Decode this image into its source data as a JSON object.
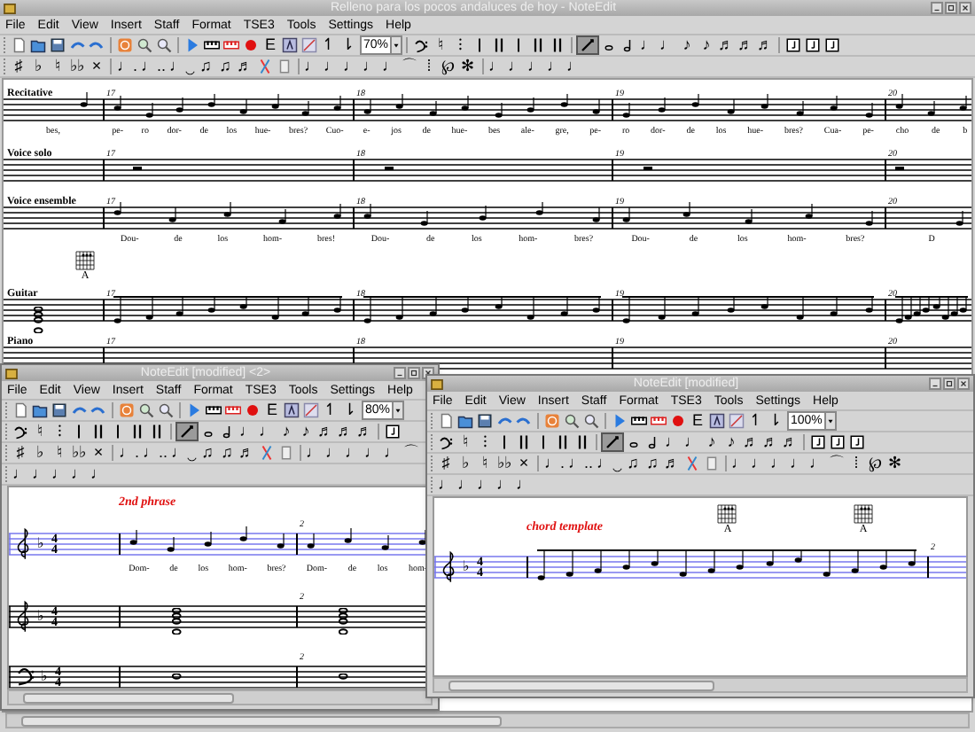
{
  "windows": [
    {
      "title": "Relleno para los pocos andaluces de hoy - NoteEdit",
      "menu": [
        "File",
        "Edit",
        "View",
        "Insert",
        "Staff",
        "Format",
        "TSE3",
        "Tools",
        "Settings",
        "Help"
      ],
      "zoom": "70%",
      "toolbars": [
        [
          {
            "kind": "new"
          },
          {
            "kind": "open"
          },
          {
            "kind": "save"
          },
          {
            "kind": "undo"
          },
          {
            "kind": "redo"
          },
          {
            "kind": "sep"
          },
          {
            "kind": "stop"
          },
          {
            "kind": "zoom-in"
          },
          {
            "kind": "zoom-out"
          },
          {
            "kind": "sep"
          },
          {
            "kind": "play"
          },
          {
            "kind": "keys"
          },
          {
            "kind": "keys-red"
          },
          {
            "kind": "record"
          },
          {
            "glyph": "E"
          },
          {
            "kind": "tool-a"
          },
          {
            "kind": "chart"
          },
          {
            "glyph": "↿"
          },
          {
            "glyph": "⇂"
          },
          {
            "kind": "zoom-select"
          },
          {
            "kind": "sep"
          },
          {
            "kind": "clef"
          },
          {
            "glyph": "♮"
          },
          {
            "glyph": "⁝"
          },
          {
            "kind": "bar"
          },
          {
            "kind": "double-bar"
          },
          {
            "kind": "bar"
          },
          {
            "kind": "double-bar"
          },
          {
            "kind": "double-bar"
          },
          {
            "kind": "sep"
          },
          {
            "kind": "pencil",
            "selected": true
          },
          {
            "kind": "whole"
          },
          {
            "kind": "half"
          },
          {
            "glyph": "♩"
          },
          {
            "glyph": "♩"
          },
          {
            "glyph": "♪"
          },
          {
            "glyph": "♪"
          },
          {
            "glyph": "♬"
          },
          {
            "glyph": "♬"
          },
          {
            "glyph": "♬"
          },
          {
            "kind": "sep"
          },
          {
            "kind": "frame"
          },
          {
            "kind": "frame"
          },
          {
            "kind": "frame"
          }
        ],
        [
          {
            "glyph": "♯"
          },
          {
            "glyph": "♭"
          },
          {
            "glyph": "♮"
          },
          {
            "glyph": "♭♭"
          },
          {
            "glyph": "×"
          },
          {
            "kind": "sep"
          },
          {
            "glyph": "♩."
          },
          {
            "glyph": "♩.."
          },
          {
            "glyph": "♩‿"
          },
          {
            "glyph": "♫"
          },
          {
            "glyph": "♫"
          },
          {
            "glyph": "♬"
          },
          {
            "kind": "tie"
          },
          {
            "kind": "small-box"
          },
          {
            "kind": "sep"
          },
          {
            "glyph": "♩"
          },
          {
            "glyph": "♩"
          },
          {
            "glyph": "♩"
          },
          {
            "glyph": "♩"
          },
          {
            "glyph": "♩"
          },
          {
            "glyph": "⌒"
          },
          {
            "glyph": "⁞"
          },
          {
            "glyph": "℘"
          },
          {
            "glyph": "✻"
          },
          {
            "kind": "sep"
          },
          {
            "glyph": "♩"
          },
          {
            "glyph": "♩"
          },
          {
            "glyph": "♩"
          },
          {
            "glyph": "♩"
          },
          {
            "glyph": "♩"
          }
        ]
      ],
      "staves": [
        {
          "label": "Recitative",
          "lead": {
            "kind": "notes",
            "lyrics": [
              "bes,"
            ]
          },
          "measures": [
            {
              "kind": "notes",
              "number": "17",
              "lyrics": [
                "pe-",
                "ro",
                "dor-",
                "de",
                "los",
                "hue-",
                "bres?",
                "Cuo-"
              ]
            },
            {
              "kind": "notes",
              "number": "18",
              "lyrics": [
                "e-",
                "jos",
                "de",
                "hue-",
                "bes",
                "ale-",
                "gre,",
                "pe-"
              ]
            },
            {
              "kind": "notes",
              "number": "19",
              "lyrics": [
                "ro",
                "dor-",
                "de",
                "los",
                "hue-",
                "bres?",
                "Cua-",
                "pe-"
              ]
            },
            {
              "kind": "notes",
              "number": "20",
              "lyrics": [
                "cho",
                "de",
                "b"
              ]
            }
          ]
        },
        {
          "label": "Voice solo",
          "measures": [
            {
              "kind": "rest",
              "number": "17"
            },
            {
              "kind": "rest",
              "number": "18"
            },
            {
              "kind": "rest",
              "number": "19"
            },
            {
              "kind": "rest",
              "number": "20"
            }
          ]
        },
        {
          "label": "Voice ensemble",
          "measures": [
            {
              "kind": "notes",
              "number": "17",
              "lyrics": [
                "Dou-",
                "de",
                "los",
                "hom-",
                "bres!"
              ]
            },
            {
              "kind": "notes",
              "number": "18",
              "lyrics": [
                "Dou-",
                "de",
                "los",
                "hom-",
                "bres?"
              ]
            },
            {
              "kind": "notes",
              "number": "19",
              "lyrics": [
                "Dou-",
                "de",
                "los",
                "hom-",
                "bres?"
              ]
            },
            {
              "kind": "notes",
              "number": "20",
              "lyrics": [
                "D"
              ]
            }
          ]
        },
        {
          "label": "Guitar",
          "lead": {
            "kind": "chord",
            "chords": [
              "A"
            ]
          },
          "measures": [
            {
              "kind": "beamed",
              "number": "17"
            },
            {
              "kind": "beamed",
              "number": "18"
            },
            {
              "kind": "beamed",
              "number": "19"
            },
            {
              "kind": "beamed",
              "number": "20"
            }
          ]
        },
        {
          "label": "Piano",
          "measures": [
            {
              "number": "17"
            },
            {
              "number": "18"
            },
            {
              "number": "19"
            },
            {
              "number": "20"
            }
          ]
        }
      ]
    },
    {
      "title": "NoteEdit [modified] <2>",
      "menu": [
        "File",
        "Edit",
        "View",
        "Insert",
        "Staff",
        "Format",
        "TSE3",
        "Tools",
        "Settings",
        "Help"
      ],
      "zoom": "80%",
      "toolbars": [
        [
          {
            "kind": "new"
          },
          {
            "kind": "open"
          },
          {
            "kind": "save"
          },
          {
            "kind": "undo"
          },
          {
            "kind": "redo"
          },
          {
            "kind": "sep"
          },
          {
            "kind": "stop"
          },
          {
            "kind": "zoom-in"
          },
          {
            "kind": "zoom-out"
          },
          {
            "kind": "sep"
          },
          {
            "kind": "play"
          },
          {
            "kind": "keys"
          },
          {
            "kind": "keys-red"
          },
          {
            "kind": "record"
          },
          {
            "glyph": "E"
          },
          {
            "kind": "tool-a"
          },
          {
            "kind": "chart"
          },
          {
            "glyph": "↿"
          },
          {
            "glyph": "⇂"
          },
          {
            "kind": "zoom-select"
          }
        ],
        [
          {
            "kind": "clef"
          },
          {
            "glyph": "♮"
          },
          {
            "glyph": "⁝"
          },
          {
            "kind": "bar"
          },
          {
            "kind": "double-bar"
          },
          {
            "kind": "bar"
          },
          {
            "kind": "double-bar"
          },
          {
            "kind": "double-bar"
          },
          {
            "kind": "sep"
          },
          {
            "kind": "pencil",
            "selected": true
          },
          {
            "kind": "whole"
          },
          {
            "kind": "half"
          },
          {
            "glyph": "♩"
          },
          {
            "glyph": "♩"
          },
          {
            "glyph": "♪"
          },
          {
            "glyph": "♪"
          },
          {
            "glyph": "♬"
          },
          {
            "glyph": "♬"
          },
          {
            "glyph": "♬"
          },
          {
            "kind": "sep"
          },
          {
            "kind": "frame"
          }
        ],
        [
          {
            "glyph": "♯"
          },
          {
            "glyph": "♭"
          },
          {
            "glyph": "♮"
          },
          {
            "glyph": "♭♭"
          },
          {
            "glyph": "×"
          },
          {
            "kind": "sep"
          },
          {
            "glyph": "♩."
          },
          {
            "glyph": "♩.."
          },
          {
            "glyph": "♩‿"
          },
          {
            "glyph": "♫"
          },
          {
            "glyph": "♫"
          },
          {
            "glyph": "♬"
          },
          {
            "kind": "tie"
          },
          {
            "kind": "small-box"
          },
          {
            "kind": "sep"
          },
          {
            "glyph": "♩"
          },
          {
            "glyph": "♩"
          },
          {
            "glyph": "♩"
          },
          {
            "glyph": "♩"
          },
          {
            "glyph": "♩"
          },
          {
            "glyph": "⌒"
          }
        ],
        [
          {
            "glyph": "♩"
          },
          {
            "glyph": "♩"
          },
          {
            "glyph": "♩"
          },
          {
            "glyph": "♩"
          },
          {
            "glyph": "♩"
          }
        ]
      ],
      "staves": [
        {
          "kind": "treble",
          "key": "♭",
          "time": [
            "4",
            "4"
          ],
          "selected": true,
          "annotation": "2nd phrase",
          "measures": [
            {
              "kind": "notes",
              "lyrics": [
                "Dom-",
                "de",
                "los",
                "hom-",
                "bres?"
              ]
            },
            {
              "kind": "notes",
              "number": "2",
              "lyrics": [
                "Dom-",
                "de",
                "los",
                "hom-"
              ]
            }
          ]
        },
        {
          "kind": "treble",
          "key": "♭",
          "time": [
            "4",
            "4"
          ],
          "selected": false,
          "measures": [
            {
              "kind": "chord"
            },
            {
              "kind": "chord",
              "number": "2"
            }
          ]
        },
        {
          "kind": "bass",
          "key": "♭",
          "time": [
            "4",
            "4"
          ],
          "selected": false,
          "measures": [
            {
              "kind": "whole"
            },
            {
              "kind": "whole",
              "number": "2"
            }
          ]
        }
      ]
    },
    {
      "title": "NoteEdit [modified]",
      "menu": [
        "File",
        "Edit",
        "View",
        "Insert",
        "Staff",
        "Format",
        "TSE3",
        "Tools",
        "Settings",
        "Help"
      ],
      "zoom": "100%",
      "toolbars": [
        [
          {
            "kind": "new"
          },
          {
            "kind": "open"
          },
          {
            "kind": "save"
          },
          {
            "kind": "undo"
          },
          {
            "kind": "redo"
          },
          {
            "kind": "sep"
          },
          {
            "kind": "stop"
          },
          {
            "kind": "zoom-in"
          },
          {
            "kind": "zoom-out"
          },
          {
            "kind": "sep"
          },
          {
            "kind": "play"
          },
          {
            "kind": "keys"
          },
          {
            "kind": "keys-red"
          },
          {
            "kind": "record"
          },
          {
            "glyph": "E"
          },
          {
            "kind": "tool-a"
          },
          {
            "kind": "chart"
          },
          {
            "glyph": "↿"
          },
          {
            "glyph": "⇂"
          },
          {
            "kind": "zoom-select"
          }
        ],
        [
          {
            "kind": "clef"
          },
          {
            "glyph": "♮"
          },
          {
            "glyph": "⁝"
          },
          {
            "kind": "bar"
          },
          {
            "kind": "double-bar"
          },
          {
            "kind": "bar"
          },
          {
            "kind": "double-bar"
          },
          {
            "kind": "double-bar"
          },
          {
            "kind": "sep"
          },
          {
            "kind": "pencil",
            "selected": true
          },
          {
            "kind": "whole"
          },
          {
            "kind": "half"
          },
          {
            "glyph": "♩"
          },
          {
            "glyph": "♩"
          },
          {
            "glyph": "♪"
          },
          {
            "glyph": "♪"
          },
          {
            "glyph": "♬"
          },
          {
            "glyph": "♬"
          },
          {
            "glyph": "♬"
          },
          {
            "kind": "sep"
          },
          {
            "kind": "frame"
          },
          {
            "kind": "frame"
          },
          {
            "kind": "frame"
          }
        ],
        [
          {
            "glyph": "♯"
          },
          {
            "glyph": "♭"
          },
          {
            "glyph": "♮"
          },
          {
            "glyph": "♭♭"
          },
          {
            "glyph": "×"
          },
          {
            "kind": "sep"
          },
          {
            "glyph": "♩."
          },
          {
            "glyph": "♩.."
          },
          {
            "glyph": "♩‿"
          },
          {
            "glyph": "♫"
          },
          {
            "glyph": "♫"
          },
          {
            "glyph": "♬"
          },
          {
            "kind": "tie"
          },
          {
            "kind": "small-box"
          },
          {
            "kind": "sep"
          },
          {
            "glyph": "♩"
          },
          {
            "glyph": "♩"
          },
          {
            "glyph": "♩"
          },
          {
            "glyph": "♩"
          },
          {
            "glyph": "♩"
          },
          {
            "glyph": "⌒"
          },
          {
            "glyph": "⁞"
          },
          {
            "glyph": "℘"
          },
          {
            "glyph": "✻"
          }
        ],
        [
          {
            "glyph": "♩"
          },
          {
            "glyph": "♩"
          },
          {
            "glyph": "♩"
          },
          {
            "glyph": "♩"
          },
          {
            "glyph": "♩"
          }
        ]
      ],
      "staves": [
        {
          "kind": "treble",
          "key": "♭",
          "time": [
            "4",
            "4"
          ],
          "selected": true,
          "annotation": "chord template",
          "measures": [
            {
              "kind": "run",
              "chords": [
                "A",
                "A"
              ]
            },
            {
              "number": "2"
            }
          ]
        }
      ]
    }
  ]
}
